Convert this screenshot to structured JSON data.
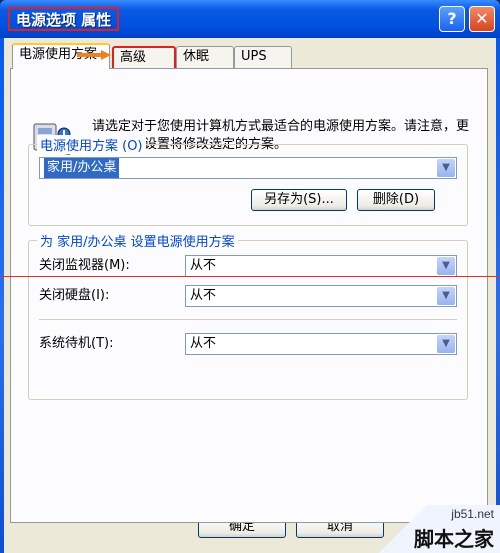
{
  "window": {
    "title": "电源选项 属性",
    "help_glyph": "?",
    "close_glyph": "✕"
  },
  "tabs": [
    {
      "label": "电源使用方案",
      "active": true
    },
    {
      "label": "高级",
      "highlighted": true
    },
    {
      "label": "休眠"
    },
    {
      "label": "UPS"
    }
  ],
  "info": {
    "icon": "power-options-icon",
    "text": "请选定对于您使用计算机方式最适合的电源使用方案。请注意，更改下面的设置将修改选定的方案。"
  },
  "scheme_group": {
    "legend": "电源使用方案 (O)",
    "selected_scheme": "家用/办公桌",
    "save_as_label": "另存为(S)...",
    "delete_label": "删除(D)"
  },
  "settings_group": {
    "legend": "为 家用/办公桌 设置电源使用方案",
    "rows": [
      {
        "label": "关闭监视器(M):",
        "value": "从不"
      },
      {
        "label": "关闭硬盘(I):",
        "value": "从不"
      },
      {
        "label": "系统待机(T):",
        "value": "从不"
      }
    ]
  },
  "footer": {
    "ok_label": "确定",
    "cancel_label": "取消"
  },
  "watermark": {
    "site": "jb51.net",
    "name": "脚本之家"
  },
  "colors": {
    "title_bar": "#0050e0",
    "annotation_red": "#e02020",
    "selection_blue": "#316ac5",
    "group_legend": "#0046d5"
  }
}
